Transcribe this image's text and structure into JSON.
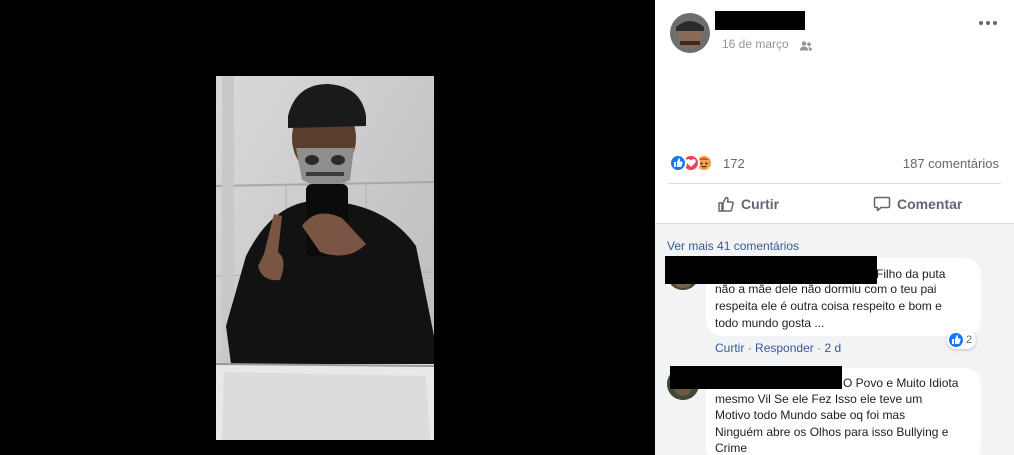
{
  "post": {
    "date": "16 de março",
    "audience_icon": "friends-icon"
  },
  "reactions": {
    "icons": [
      "like-icon",
      "love-icon",
      "angry-icon"
    ],
    "count": "172",
    "comments_count": "187 comentários"
  },
  "actions": {
    "like_label": "Curtir",
    "comment_label": "Comentar"
  },
  "comments_section": {
    "view_more": "Ver mais 41 comentários",
    "comments": [
      {
        "lines": [
          "Filho da puta",
          "não a mãe dele não dormiu com o teu pai",
          "respeita ele é outra coisa respeito e bom e",
          "todo mundo gosta ..."
        ],
        "like_label": "Curtir",
        "reply_label": "Responder",
        "time": "2 d",
        "reaction_count": "2"
      },
      {
        "lines": [
          "O Povo e Muito Idiota",
          "mesmo Vil Se ele Fez Isso ele teve um",
          "Motivo todo Mundo sabe oq foi mas",
          "Ninguém abre os Olhos para isso Bullying e",
          "Crime"
        ]
      }
    ]
  },
  "colors": {
    "link": "#385898",
    "like_blue": "#1877f2",
    "love_red": "#f33e58",
    "angry_orange": "#e9710f",
    "bubble_bg": "#ffffff",
    "comments_bg": "#f2f3f5"
  }
}
